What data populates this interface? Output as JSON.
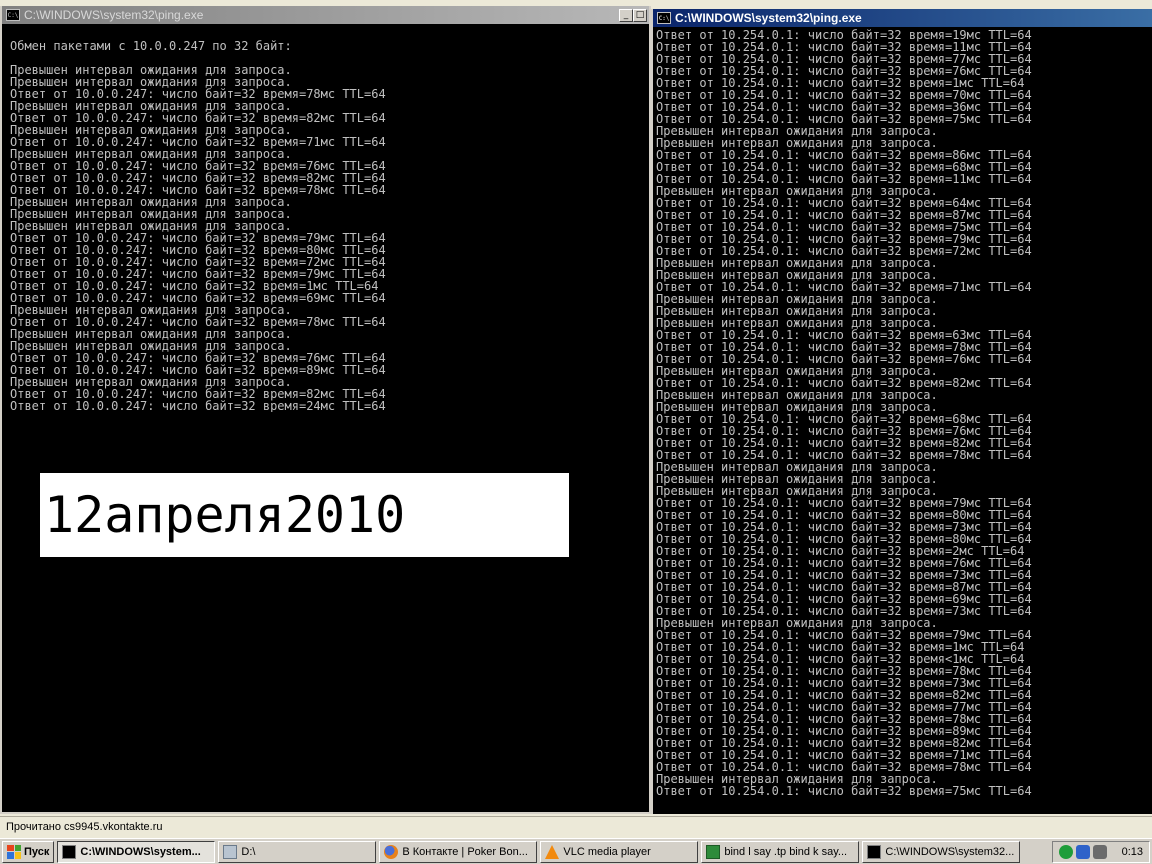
{
  "left_window": {
    "title": "C:\\WINDOWS\\system32\\ping.exe",
    "console_lines": [
      "",
      "Обмен пакетами с 10.0.0.247 по 32 байт:",
      "",
      "Превышен интервал ожидания для запроса.",
      "Превышен интервал ожидания для запроса.",
      "Ответ от 10.0.0.247: число байт=32 время=78мс TTL=64",
      "Превышен интервал ожидания для запроса.",
      "Ответ от 10.0.0.247: число байт=32 время=82мс TTL=64",
      "Превышен интервал ожидания для запроса.",
      "Ответ от 10.0.0.247: число байт=32 время=71мс TTL=64",
      "Превышен интервал ожидания для запроса.",
      "Ответ от 10.0.0.247: число байт=32 время=76мс TTL=64",
      "Ответ от 10.0.0.247: число байт=32 время=82мс TTL=64",
      "Ответ от 10.0.0.247: число байт=32 время=78мс TTL=64",
      "Превышен интервал ожидания для запроса.",
      "Превышен интервал ожидания для запроса.",
      "Превышен интервал ожидания для запроса.",
      "Ответ от 10.0.0.247: число байт=32 время=79мс TTL=64",
      "Ответ от 10.0.0.247: число байт=32 время=80мс TTL=64",
      "Ответ от 10.0.0.247: число байт=32 время=72мс TTL=64",
      "Ответ от 10.0.0.247: число байт=32 время=79мс TTL=64",
      "Ответ от 10.0.0.247: число байт=32 время=1мс TTL=64",
      "Ответ от 10.0.0.247: число байт=32 время=69мс TTL=64",
      "Превышен интервал ожидания для запроса.",
      "Ответ от 10.0.0.247: число байт=32 время=78мс TTL=64",
      "Превышен интервал ожидания для запроса.",
      "Превышен интервал ожидания для запроса.",
      "Ответ от 10.0.0.247: число байт=32 время=76мс TTL=64",
      "Ответ от 10.0.0.247: число байт=32 время=89мс TTL=64",
      "Превышен интервал ожидания для запроса.",
      "Ответ от 10.0.0.247: число байт=32 время=82мс TTL=64",
      "Ответ от 10.0.0.247: число байт=32 время=24мс TTL=64"
    ],
    "controls": {
      "minimize": "_",
      "maximize": "□"
    }
  },
  "date_overlay": "12апреля2010",
  "right_window": {
    "title": "C:\\WINDOWS\\system32\\ping.exe",
    "console_lines": [
      "Ответ от 10.254.0.1: число байт=32 время=19мс TTL=64",
      "Ответ от 10.254.0.1: число байт=32 время=11мс TTL=64",
      "Ответ от 10.254.0.1: число байт=32 время=77мс TTL=64",
      "Ответ от 10.254.0.1: число байт=32 время=76мс TTL=64",
      "Ответ от 10.254.0.1: число байт=32 время=1мс TTL=64",
      "Ответ от 10.254.0.1: число байт=32 время=70мс TTL=64",
      "Ответ от 10.254.0.1: число байт=32 время=36мс TTL=64",
      "Ответ от 10.254.0.1: число байт=32 время=75мс TTL=64",
      "Превышен интервал ожидания для запроса.",
      "Превышен интервал ожидания для запроса.",
      "Ответ от 10.254.0.1: число байт=32 время=86мс TTL=64",
      "Ответ от 10.254.0.1: число байт=32 время=68мс TTL=64",
      "Ответ от 10.254.0.1: число байт=32 время=11мс TTL=64",
      "Превышен интервал ожидания для запроса.",
      "Ответ от 10.254.0.1: число байт=32 время=64мс TTL=64",
      "Ответ от 10.254.0.1: число байт=32 время=87мс TTL=64",
      "Ответ от 10.254.0.1: число байт=32 время=75мс TTL=64",
      "Ответ от 10.254.0.1: число байт=32 время=79мс TTL=64",
      "Ответ от 10.254.0.1: число байт=32 время=72мс TTL=64",
      "Превышен интервал ожидания для запроса.",
      "Превышен интервал ожидания для запроса.",
      "Ответ от 10.254.0.1: число байт=32 время=71мс TTL=64",
      "Превышен интервал ожидания для запроса.",
      "Превышен интервал ожидания для запроса.",
      "Превышен интервал ожидания для запроса.",
      "Ответ от 10.254.0.1: число байт=32 время=63мс TTL=64",
      "Ответ от 10.254.0.1: число байт=32 время=78мс TTL=64",
      "Ответ от 10.254.0.1: число байт=32 время=76мс TTL=64",
      "Превышен интервал ожидания для запроса.",
      "Ответ от 10.254.0.1: число байт=32 время=82мс TTL=64",
      "Превышен интервал ожидания для запроса.",
      "Превышен интервал ожидания для запроса.",
      "Ответ от 10.254.0.1: число байт=32 время=68мс TTL=64",
      "Ответ от 10.254.0.1: число байт=32 время=76мс TTL=64",
      "Ответ от 10.254.0.1: число байт=32 время=82мс TTL=64",
      "Ответ от 10.254.0.1: число байт=32 время=78мс TTL=64",
      "Превышен интервал ожидания для запроса.",
      "Превышен интервал ожидания для запроса.",
      "Превышен интервал ожидания для запроса.",
      "Ответ от 10.254.0.1: число байт=32 время=79мс TTL=64",
      "Ответ от 10.254.0.1: число байт=32 время=80мс TTL=64",
      "Ответ от 10.254.0.1: число байт=32 время=73мс TTL=64",
      "Ответ от 10.254.0.1: число байт=32 время=80мс TTL=64",
      "Ответ от 10.254.0.1: число байт=32 время=2мс TTL=64",
      "Ответ от 10.254.0.1: число байт=32 время=76мс TTL=64",
      "Ответ от 10.254.0.1: число байт=32 время=73мс TTL=64",
      "Ответ от 10.254.0.1: число байт=32 время=87мс TTL=64",
      "Ответ от 10.254.0.1: число байт=32 время=69мс TTL=64",
      "Ответ от 10.254.0.1: число байт=32 время=73мс TTL=64",
      "Превышен интервал ожидания для запроса.",
      "Ответ от 10.254.0.1: число байт=32 время=79мс TTL=64",
      "Ответ от 10.254.0.1: число байт=32 время=1мс TTL=64",
      "Ответ от 10.254.0.1: число байт=32 время<1мс TTL=64",
      "Ответ от 10.254.0.1: число байт=32 время=78мс TTL=64",
      "Ответ от 10.254.0.1: число байт=32 время=73мс TTL=64",
      "Ответ от 10.254.0.1: число байт=32 время=82мс TTL=64",
      "Ответ от 10.254.0.1: число байт=32 время=77мс TTL=64",
      "Ответ от 10.254.0.1: число байт=32 время=78мс TTL=64",
      "Ответ от 10.254.0.1: число байт=32 время=89мс TTL=64",
      "Ответ от 10.254.0.1: число байт=32 время=82мс TTL=64",
      "Ответ от 10.254.0.1: число байт=32 время=71мс TTL=64",
      "Ответ от 10.254.0.1: число байт=32 время=78мс TTL=64",
      "Превышен интервал ожидания для запроса.",
      "Ответ от 10.254.0.1: число байт=32 время=75мс TTL=64"
    ]
  },
  "statusbar": {
    "text": "Прочитано cs9945.vkontakte.ru"
  },
  "taskbar": {
    "start_label": "Пуск",
    "buttons": [
      {
        "label": "C:\\WINDOWS\\system...",
        "icon": "cmd-icon"
      },
      {
        "label": "D:\\",
        "icon": "drive-icon"
      },
      {
        "label": "В Контакте | Poker Bon...",
        "icon": "firefox-icon"
      },
      {
        "label": "VLC media player",
        "icon": "vlc-icon"
      },
      {
        "label": "bind l say .tp    bind k say...",
        "icon": "notepad-icon"
      },
      {
        "label": "C:\\WINDOWS\\system32...",
        "icon": "cmd-icon"
      }
    ],
    "clock": "0:13"
  },
  "colors": {
    "console_bg": "#000000",
    "console_text": "#c0c0c0",
    "active_title": "#0a246a",
    "inactive_title": "#808080",
    "taskbar": "#d4d0c8"
  }
}
